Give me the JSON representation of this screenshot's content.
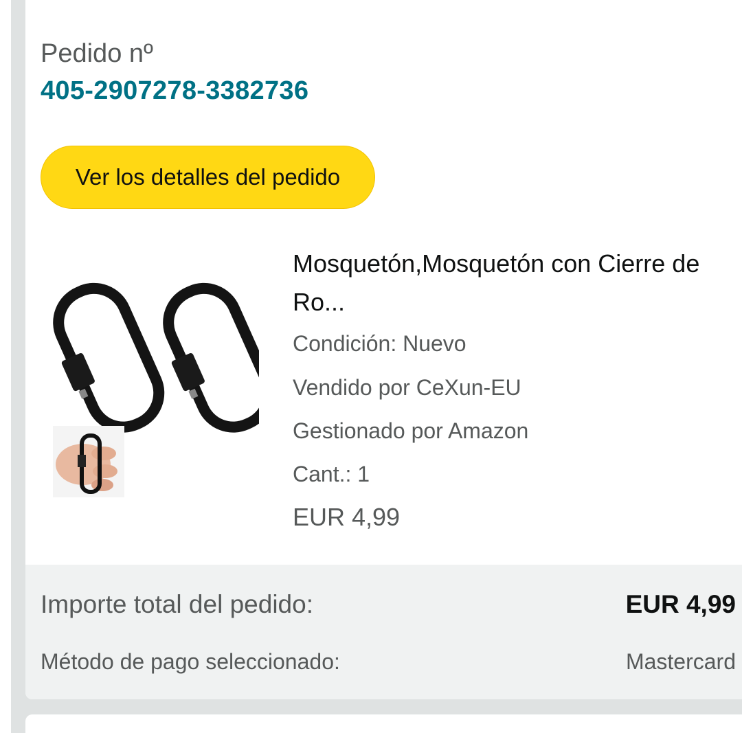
{
  "order": {
    "label": "Pedido nº",
    "number": "405-2907278-3382736",
    "details_button": "Ver los detalles del pedido"
  },
  "product": {
    "title": "Mosquetón,Mosquetón con Cierre de Ro...",
    "condition": "Condición: Nuevo",
    "seller": "Vendido por CeXun-EU",
    "fulfilled": "Gestionado por Amazon",
    "quantity": "Cant.: 1",
    "price": "EUR 4,99",
    "image_icon": "carabiner-product-image"
  },
  "summary": {
    "total_label": "Importe total del pedido:",
    "total_value": "EUR 4,99",
    "payment_label": "Método de pago seleccionado:",
    "payment_value": "Mastercard"
  },
  "colors": {
    "link": "#007185",
    "button": "#ffd814",
    "summary_bg": "#f0f2f2",
    "page_bg": "#dfe2e2"
  }
}
